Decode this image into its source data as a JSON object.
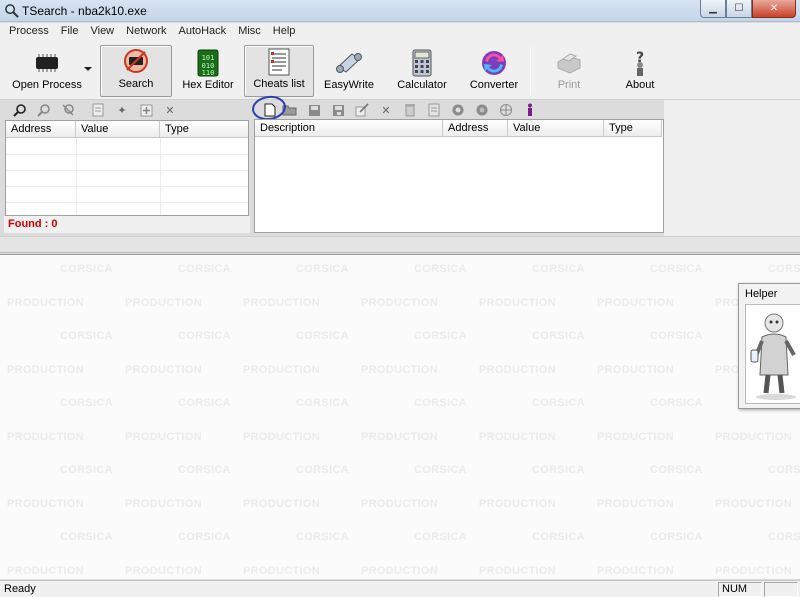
{
  "window": {
    "title": "TSearch - nba2k10.exe"
  },
  "menu": [
    "Process",
    "File",
    "View",
    "Network",
    "AutoHack",
    "Misc",
    "Help"
  ],
  "toolbar": {
    "open_process": "Open Process",
    "search": "Search",
    "hex_editor": "Hex Editor",
    "cheats_list": "Cheats list",
    "easywrite": "EasyWrite",
    "calculator": "Calculator",
    "converter": "Converter",
    "print": "Print",
    "about": "About"
  },
  "search_list": {
    "columns": [
      "Address",
      "Value",
      "Type"
    ],
    "found_label": "Found : 0"
  },
  "cheats_list": {
    "columns": [
      "Description",
      "Address",
      "Value",
      "Type"
    ]
  },
  "watermark": {
    "line1": "CORSICA",
    "line2": "PRODUCTION"
  },
  "helper": {
    "title": "Helper"
  },
  "status": {
    "text": "Ready",
    "num": "NUM"
  },
  "colors": {
    "found_red": "#d40000",
    "annotation_blue": "#2a3fb0"
  }
}
